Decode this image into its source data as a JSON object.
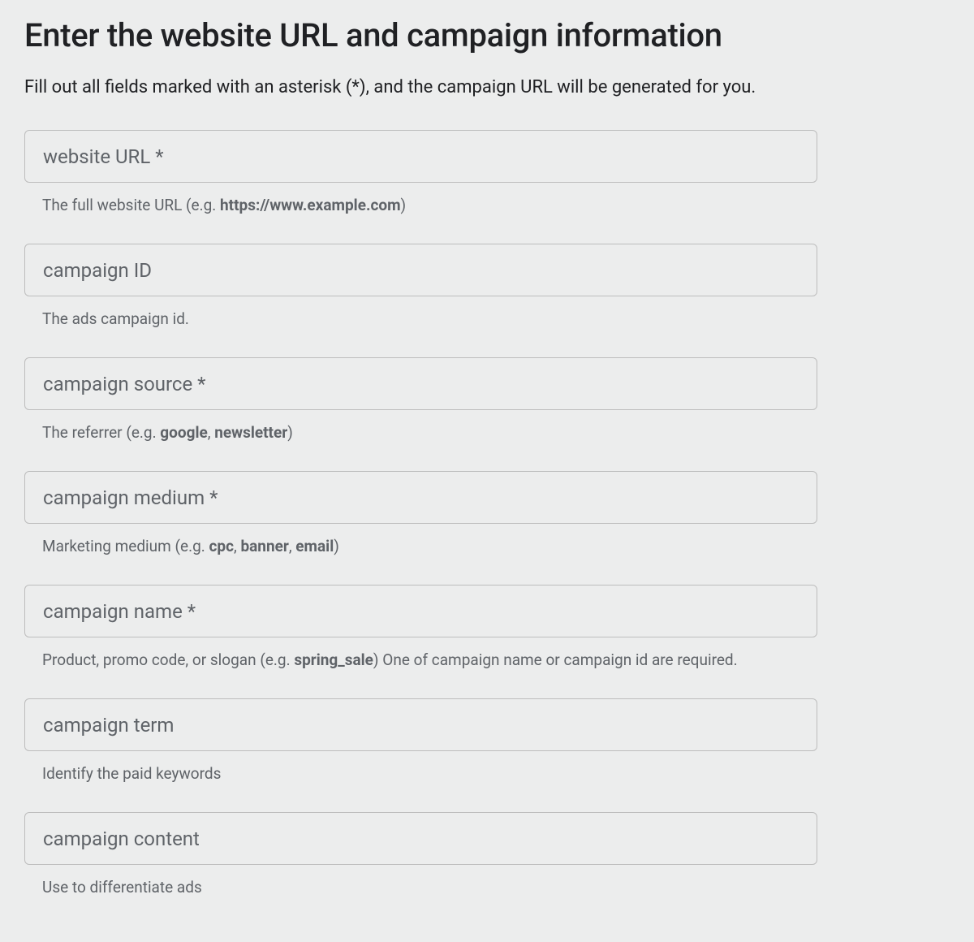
{
  "header": {
    "title": "Enter the website URL and campaign information",
    "subtitle": "Fill out all fields marked with an asterisk (*), and the campaign URL will be generated for you."
  },
  "fields": {
    "website_url": {
      "placeholder": "website URL *",
      "helper_prefix": "The full website URL (e.g. ",
      "helper_bold1": "https://www.example.com",
      "helper_suffix": ")"
    },
    "campaign_id": {
      "placeholder": "campaign ID",
      "helper": "The ads campaign id."
    },
    "campaign_source": {
      "placeholder": "campaign source *",
      "helper_prefix": "The referrer (e.g. ",
      "helper_bold1": "google",
      "helper_sep1": ", ",
      "helper_bold2": "newsletter",
      "helper_suffix": ")"
    },
    "campaign_medium": {
      "placeholder": "campaign medium *",
      "helper_prefix": "Marketing medium (e.g. ",
      "helper_bold1": "cpc",
      "helper_sep1": ", ",
      "helper_bold2": "banner",
      "helper_sep2": ", ",
      "helper_bold3": "email",
      "helper_suffix": ")"
    },
    "campaign_name": {
      "placeholder": "campaign name *",
      "helper_prefix": "Product, promo code, or slogan (e.g. ",
      "helper_bold1": "spring_sale",
      "helper_suffix": ") One of campaign name or campaign id are required."
    },
    "campaign_term": {
      "placeholder": "campaign term",
      "helper": "Identify the paid keywords"
    },
    "campaign_content": {
      "placeholder": "campaign content",
      "helper": "Use to differentiate ads"
    }
  }
}
